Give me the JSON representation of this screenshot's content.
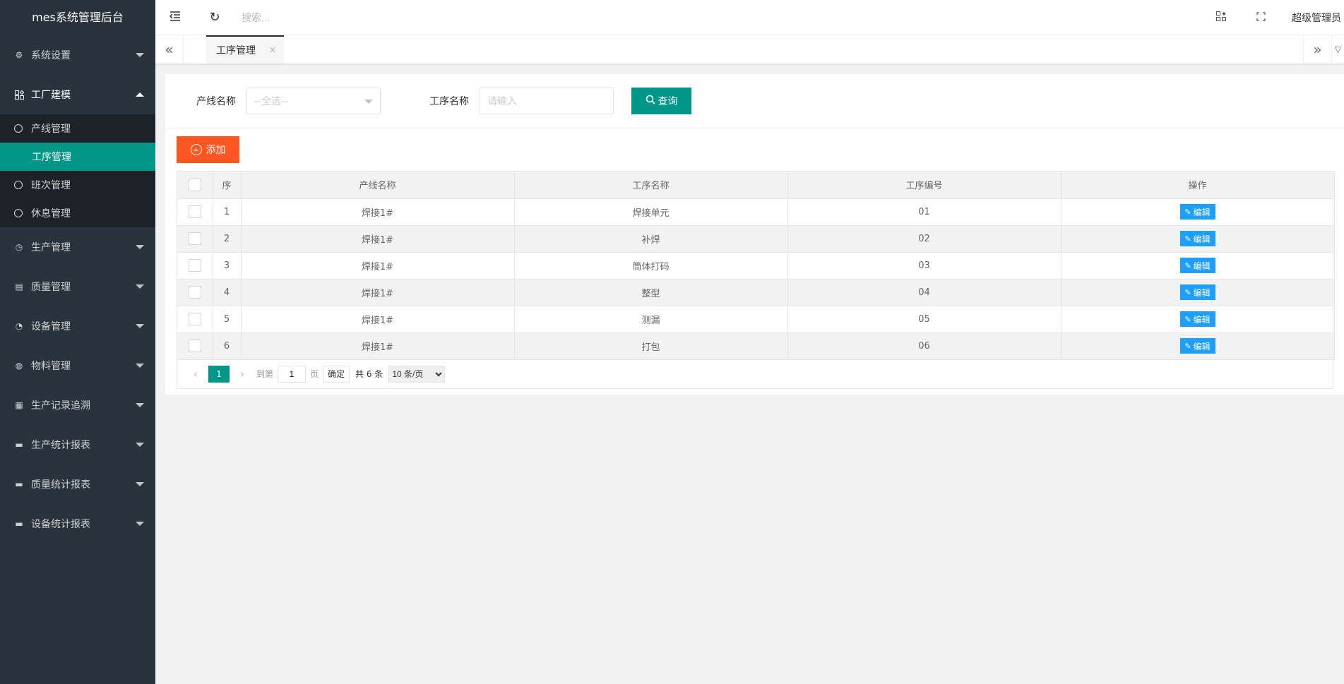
{
  "app": {
    "title": "mes系统管理后台"
  },
  "sidebar": {
    "menu": [
      {
        "label": "系统设置",
        "icon": "gear-icon"
      },
      {
        "label": "工厂建模",
        "icon": "apps-icon",
        "open": true,
        "children": [
          {
            "label": "产线管理"
          },
          {
            "label": "工序管理",
            "active": true
          },
          {
            "label": "班次管理"
          },
          {
            "label": "休息管理"
          }
        ]
      },
      {
        "label": "生产管理",
        "icon": "clock-icon"
      },
      {
        "label": "质量管理",
        "icon": "file-icon"
      },
      {
        "label": "设备管理",
        "icon": "gauge-icon"
      },
      {
        "label": "物料管理",
        "icon": "globe-icon"
      },
      {
        "label": "生产记录追溯",
        "icon": "table-icon"
      },
      {
        "label": "生产统计报表",
        "icon": "monitor-icon"
      },
      {
        "label": "质量统计报表",
        "icon": "monitor-icon"
      },
      {
        "label": "设备统计报表",
        "icon": "monitor-icon"
      }
    ]
  },
  "header": {
    "search_placeholder": "搜索...",
    "user": "超级管理员"
  },
  "tabs": [
    {
      "label": "工序管理",
      "close": "×"
    }
  ],
  "filter": {
    "line_label": "产线名称",
    "line_placeholder": "--全选--",
    "process_label": "工序名称",
    "process_placeholder": "请输入",
    "query_label": "查询"
  },
  "toolbar": {
    "add_label": "添加"
  },
  "table": {
    "columns": [
      "序",
      "产线名称",
      "工序名称",
      "工序编号",
      "操作"
    ],
    "edit_label": "编辑",
    "rows": [
      {
        "no": "1",
        "line": "焊接1#",
        "process": "焊接单元",
        "code": "01"
      },
      {
        "no": "2",
        "line": "焊接1#",
        "process": "补焊",
        "code": "02"
      },
      {
        "no": "3",
        "line": "焊接1#",
        "process": "筒体打码",
        "code": "03"
      },
      {
        "no": "4",
        "line": "焊接1#",
        "process": "整型",
        "code": "04"
      },
      {
        "no": "5",
        "line": "焊接1#",
        "process": "测漏",
        "code": "05"
      },
      {
        "no": "6",
        "line": "焊接1#",
        "process": "打包",
        "code": "06"
      }
    ]
  },
  "pager": {
    "current": "1",
    "goto_label": "到第",
    "page_input": "1",
    "page_unit": "页",
    "ok_label": "确定",
    "total": "共 6 条",
    "per_page": "10 条/页"
  },
  "colors": {
    "primary": "#009688",
    "add": "#ff5722",
    "edit": "#1e9fff",
    "sidebar": "#28333e"
  }
}
